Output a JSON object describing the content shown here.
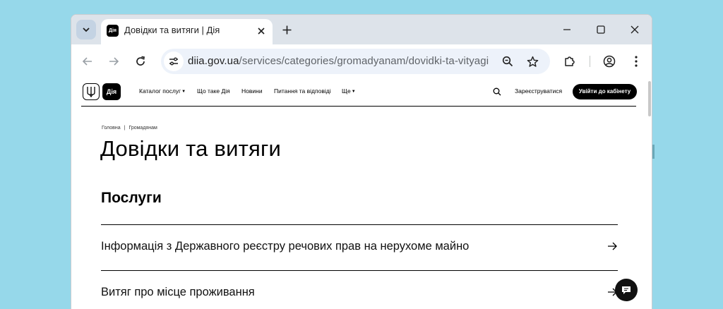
{
  "browser": {
    "tab_title": "Довідки та витяги | Дія",
    "favicon_text": "Дія",
    "url_host": "diia.gov.ua",
    "url_path": "/services/categories/gromadyanam/dovidki-ta-vityagi"
  },
  "site": {
    "logo_text": "Дія",
    "nav": [
      "Каталог послуг",
      "Що таке Дія",
      "Новини",
      "Питання та відповіді",
      "Ще"
    ],
    "register_label": "Зареєструватися",
    "cabinet_label": "Увійти до кабінету"
  },
  "page": {
    "breadcrumb": [
      "Головна",
      "Громадянам"
    ],
    "title": "Довідки та витяги",
    "section_title": "Послуги",
    "services": [
      "Інформація з Державного реєстру речових прав на нерухоме майно",
      "Витяг про місце проживання"
    ]
  },
  "colors": {
    "desktop": "#96d8ea",
    "tabbar": "#dde3ea",
    "omnibox": "#edf2fa",
    "brand_black": "#000000"
  },
  "icons": [
    "tab-search-icon",
    "close-icon",
    "plus-icon",
    "minimize-icon",
    "maximize-icon",
    "window-close-icon",
    "back-arrow-icon",
    "forward-arrow-icon",
    "reload-icon",
    "site-settings-icon",
    "zoom-icon",
    "star-icon",
    "extensions-icon",
    "profile-icon",
    "menu-dots-icon",
    "trident-icon",
    "search-icon",
    "arrow-right-icon",
    "chat-icon"
  ]
}
